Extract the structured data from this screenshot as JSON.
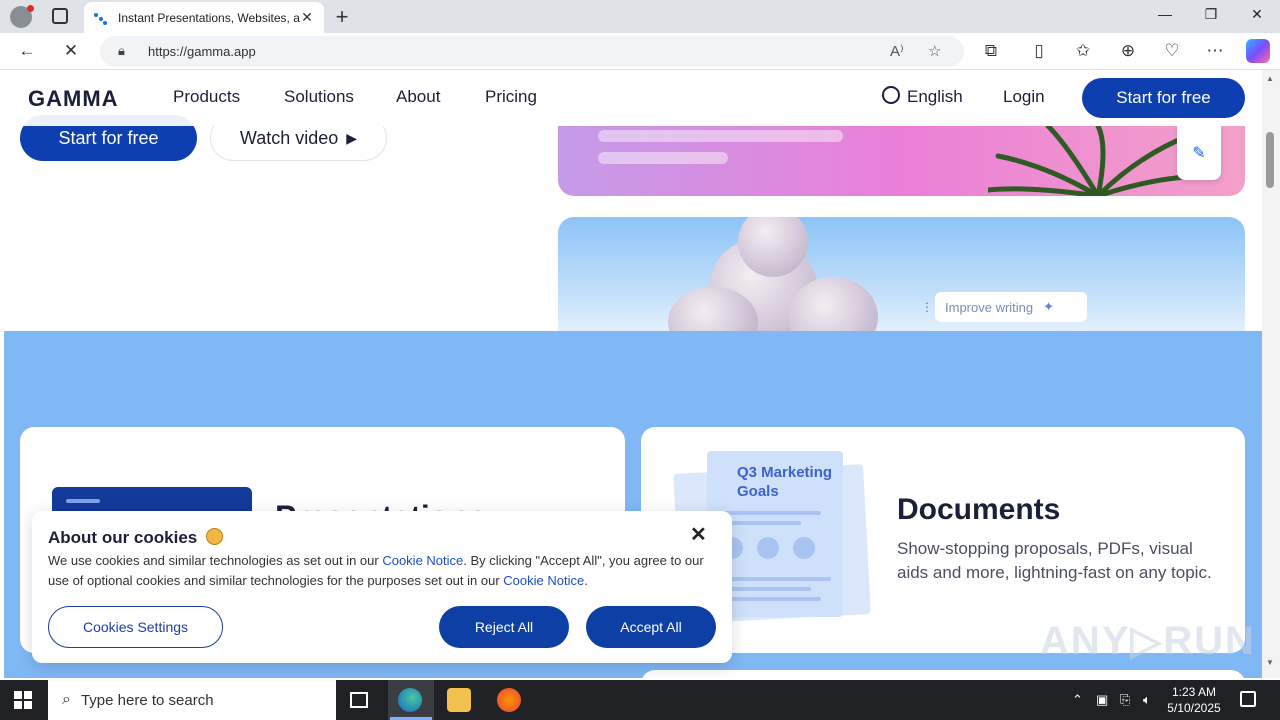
{
  "browser": {
    "tab_title": "Instant Presentations, Websites, a",
    "tab_close": "✕",
    "new_tab": "+",
    "url": "https://gamma.app",
    "min": "—",
    "max": "❐",
    "close": "✕"
  },
  "nav": {
    "logo": "GAMMA",
    "links": [
      "Products",
      "Solutions",
      "About",
      "Pricing"
    ],
    "language": "English",
    "login": "Login",
    "cta": "Start for free"
  },
  "hero": {
    "primary": "Start for free",
    "secondary": "Watch video"
  },
  "sky_card": {
    "improve_label": "Improve writing"
  },
  "cards": {
    "presentations_heading": "Presentations",
    "documents_thumb_title": "Q3 Marketing Goals",
    "documents_heading": "Documents",
    "documents_text": "Show-stopping proposals, PDFs, visual aids and more, lightning-fast on any topic."
  },
  "cookie": {
    "title": "About our cookies",
    "text_1": "We use cookies and similar technologies as set out in our ",
    "link_1": "Cookie Notice",
    "text_2": ". By clicking \"Accept All\", you agree to our use of optional cookies and similar technologies for the purposes set out in our ",
    "link_2": "Cookie Notice",
    "text_3": ".",
    "settings": "Cookies Settings",
    "reject": "Reject All",
    "accept": "Accept All",
    "close": "✕"
  },
  "watermark": "ANY▷RUN",
  "taskbar": {
    "search_placeholder": "Type here to search",
    "time": "1:23 AM",
    "date": "5/10/2025"
  },
  "colors": {
    "brand_blue": "#0d3fb0",
    "band_blue": "#7fb8f5",
    "link_blue": "#1d4fbf"
  }
}
